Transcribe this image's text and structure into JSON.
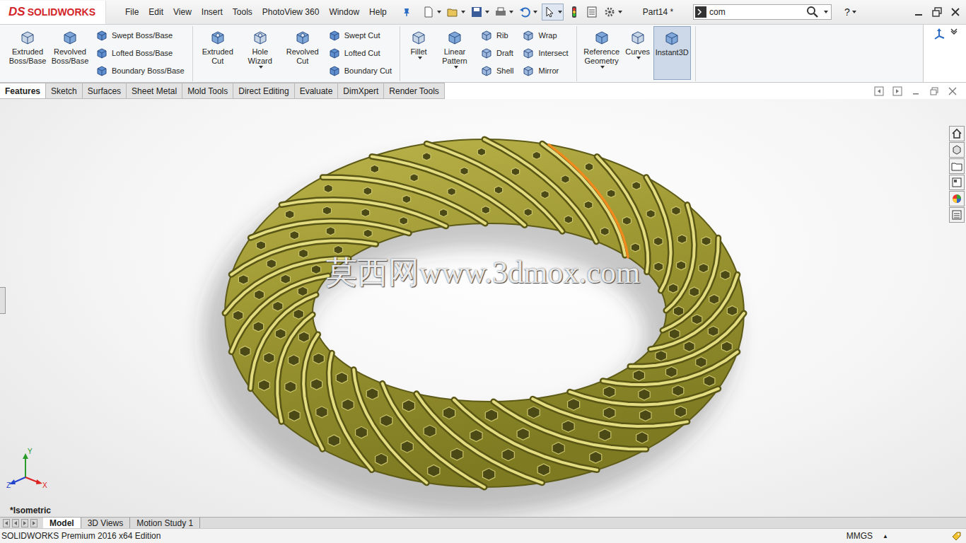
{
  "logo": {
    "mark": "DS",
    "name": "SOLIDWORKS"
  },
  "menu": [
    "File",
    "Edit",
    "View",
    "Insert",
    "Tools",
    "PhotoView 360",
    "Window",
    "Help"
  ],
  "document": {
    "title": "Part14 *"
  },
  "search": {
    "value": "com"
  },
  "help": {
    "label": "?"
  },
  "ribbon": {
    "groups": [
      {
        "items": [
          {
            "kind": "large",
            "label": "Extruded Boss/Base",
            "dropdown": false,
            "selected": false
          },
          {
            "kind": "large",
            "label": "Revolved Boss/Base",
            "dropdown": false,
            "selected": false
          },
          {
            "kind": "stack",
            "items": [
              {
                "label": "Swept Boss/Base",
                "selected": false
              },
              {
                "label": "Lofted Boss/Base",
                "selected": false
              },
              {
                "label": "Boundary Boss/Base",
                "selected": false
              }
            ]
          }
        ]
      },
      {
        "items": [
          {
            "kind": "large",
            "label": "Extruded Cut",
            "dropdown": false,
            "selected": false
          },
          {
            "kind": "large",
            "label": "Hole Wizard",
            "dropdown": true,
            "selected": false
          },
          {
            "kind": "large",
            "label": "Revolved Cut",
            "dropdown": false,
            "selected": false
          },
          {
            "kind": "stack",
            "items": [
              {
                "label": "Swept Cut",
                "selected": false
              },
              {
                "label": "Lofted Cut",
                "selected": false
              },
              {
                "label": "Boundary Cut",
                "selected": false
              }
            ]
          }
        ]
      },
      {
        "items": [
          {
            "kind": "large",
            "label": "Fillet",
            "dropdown": true,
            "selected": false
          },
          {
            "kind": "large",
            "label": "Linear Pattern",
            "dropdown": true,
            "selected": false
          },
          {
            "kind": "stack",
            "items": [
              {
                "label": "Rib",
                "selected": false
              },
              {
                "label": "Draft",
                "selected": false
              },
              {
                "label": "Shell",
                "selected": false
              }
            ]
          },
          {
            "kind": "stack",
            "items": [
              {
                "label": "Wrap",
                "selected": false
              },
              {
                "label": "Intersect",
                "selected": false
              },
              {
                "label": "Mirror",
                "selected": false
              }
            ]
          }
        ]
      },
      {
        "items": [
          {
            "kind": "large",
            "label": "Reference Geometry",
            "dropdown": true,
            "selected": false
          },
          {
            "kind": "large",
            "label": "Curves",
            "dropdown": true,
            "selected": false
          },
          {
            "kind": "large",
            "label": "Instant3D",
            "dropdown": false,
            "selected": true
          }
        ]
      }
    ]
  },
  "tabs": [
    {
      "label": "Features",
      "selected": true
    },
    {
      "label": "Sketch",
      "selected": false
    },
    {
      "label": "Surfaces",
      "selected": false
    },
    {
      "label": "Sheet Metal",
      "selected": false
    },
    {
      "label": "Mold Tools",
      "selected": false
    },
    {
      "label": "Direct Editing",
      "selected": false
    },
    {
      "label": "Evaluate",
      "selected": false
    },
    {
      "label": "DimXpert",
      "selected": false
    },
    {
      "label": "Render Tools",
      "selected": false
    }
  ],
  "viewport": {
    "watermark": "莫西网www.3dmox.com",
    "view_label": "*Isometric",
    "triad": {
      "x": "X",
      "y": "Y",
      "z": "Z"
    },
    "model": {
      "selected_edge": true
    }
  },
  "bottom_tabs": [
    {
      "label": "Model",
      "selected": true
    },
    {
      "label": "3D Views",
      "selected": false
    },
    {
      "label": "Motion Study 1",
      "selected": false
    }
  ],
  "status_bar": {
    "edition": "SOLIDWORKS Premium 2016 x64 Edition",
    "units": "MMGS",
    "units_arrow": "▲"
  }
}
